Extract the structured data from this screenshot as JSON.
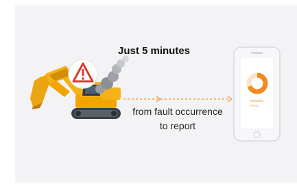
{
  "headline": "Just 5 minutes",
  "caption": {
    "line1": "from fault occurrence",
    "line2": "to report"
  },
  "icons": {
    "machine": "excavator-icon",
    "alert": "warning-triangle-icon",
    "exhaust": "smoke-icon",
    "device": "smartphone-icon",
    "screen_graphic": "donut-chart-icon"
  },
  "colors": {
    "background": "#f3f3f5",
    "excavator": "#f0a500",
    "alert_red": "#d83a2c",
    "arrow": "#f2a34a",
    "donut": "#f28a1e",
    "phone_body": "#f7f7f9"
  }
}
